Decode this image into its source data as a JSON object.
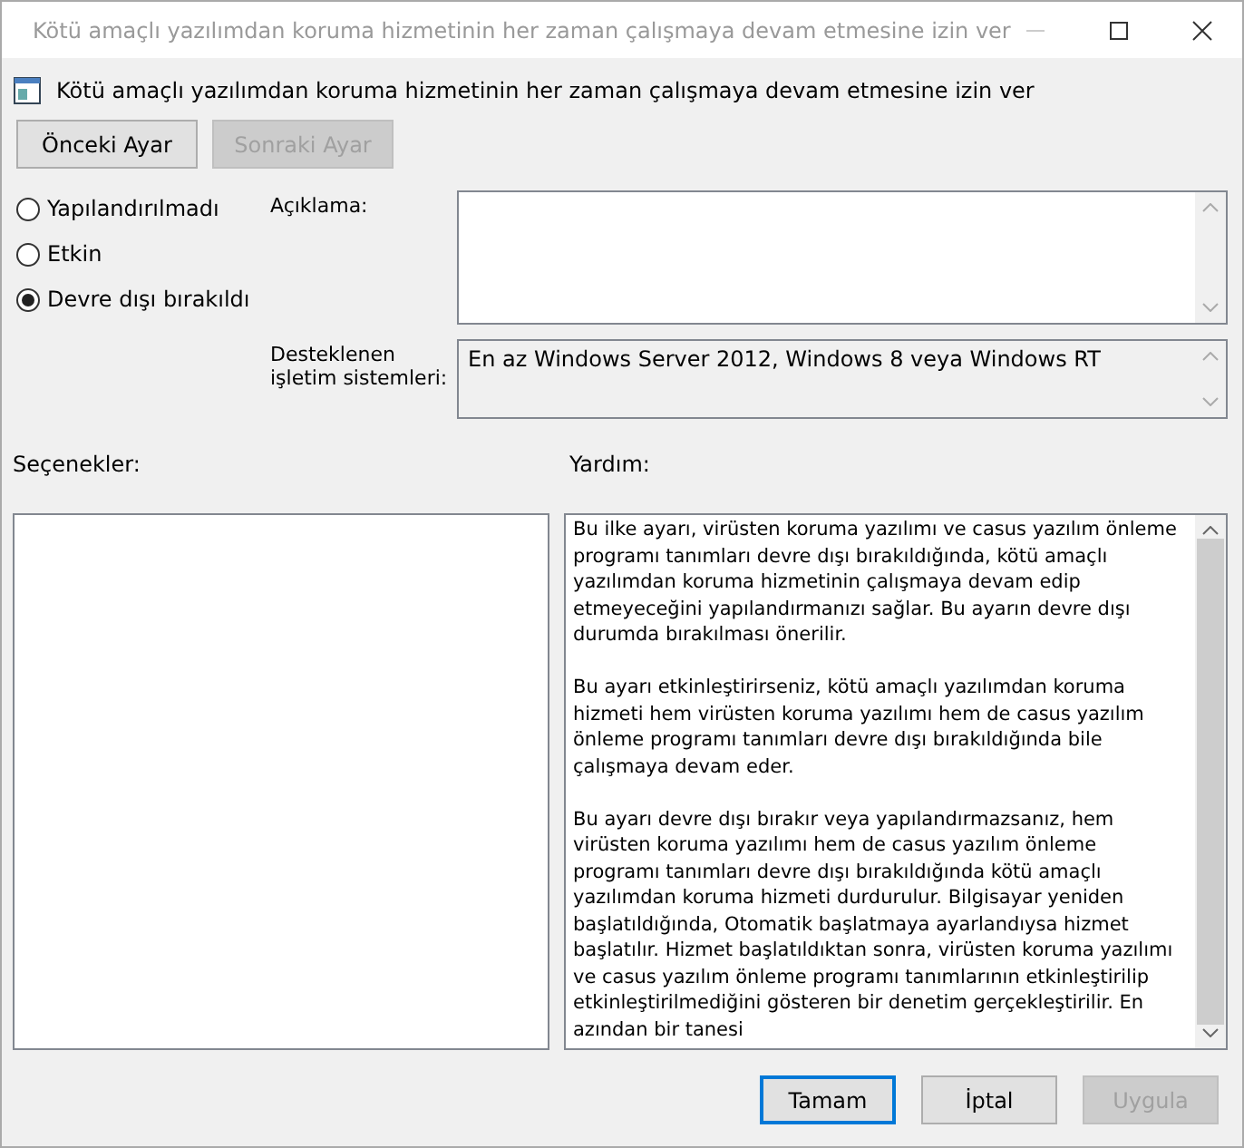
{
  "window": {
    "title": "Kötü amaçlı yazılımdan koruma hizmetinin her zaman çalışmaya devam etmesine izin ver"
  },
  "header": {
    "title": "Kötü amaçlı yazılımdan koruma hizmetinin her zaman çalışmaya devam etmesine izin ver"
  },
  "nav_buttons": [
    {
      "label": "Önceki Ayar",
      "disabled": false
    },
    {
      "label": "Sonraki Ayar",
      "disabled": true
    }
  ],
  "state_options": [
    {
      "label": "Yapılandırılmadı",
      "selected": false
    },
    {
      "label": "Etkin",
      "selected": false
    },
    {
      "label": "Devre dışı bırakıldı",
      "selected": true
    }
  ],
  "comment": {
    "label": "Açıklama:"
  },
  "supported": {
    "label": "Desteklenen işletim sistemleri:",
    "value": "En az Windows Server 2012, Windows 8 veya Windows RT"
  },
  "options": {
    "label": "Seçenekler:"
  },
  "help": {
    "label": "Yardım:",
    "paragraphs": [
      "Bu ilke ayarı, virüsten koruma yazılımı ve casus yazılım önleme programı tanımları devre dışı bırakıldığında, kötü amaçlı yazılımdan koruma hizmetinin çalışmaya devam edip etmeyeceğini yapılandırmanızı sağlar. Bu ayarın devre dışı durumda bırakılması önerilir.",
      "Bu ayarı etkinleştirirseniz, kötü amaçlı yazılımdan koruma hizmeti hem virüsten koruma yazılımı hem de casus yazılım önleme programı tanımları devre dışı bırakıldığında bile çalışmaya devam eder.",
      "Bu ayarı devre dışı bırakır veya yapılandırmazsanız, hem virüsten koruma yazılımı hem de casus yazılım önleme programı tanımları devre dışı bırakıldığında kötü amaçlı yazılımdan koruma hizmeti durdurulur. Bilgisayar yeniden başlatıldığında, Otomatik başlatmaya ayarlandıysa hizmet başlatılır. Hizmet başlatıldıktan sonra, virüsten koruma yazılımı ve casus yazılım önleme programı tanımlarının etkinleştirilip etkinleştirilmediğini gösteren bir denetim gerçekleştirilir. En azından bir tanesi"
    ]
  },
  "buttons": [
    {
      "label": "Tamam",
      "disabled": false,
      "default": true
    },
    {
      "label": "İptal",
      "disabled": false,
      "default": false
    },
    {
      "label": "Uygula",
      "disabled": true,
      "default": false
    }
  ]
}
